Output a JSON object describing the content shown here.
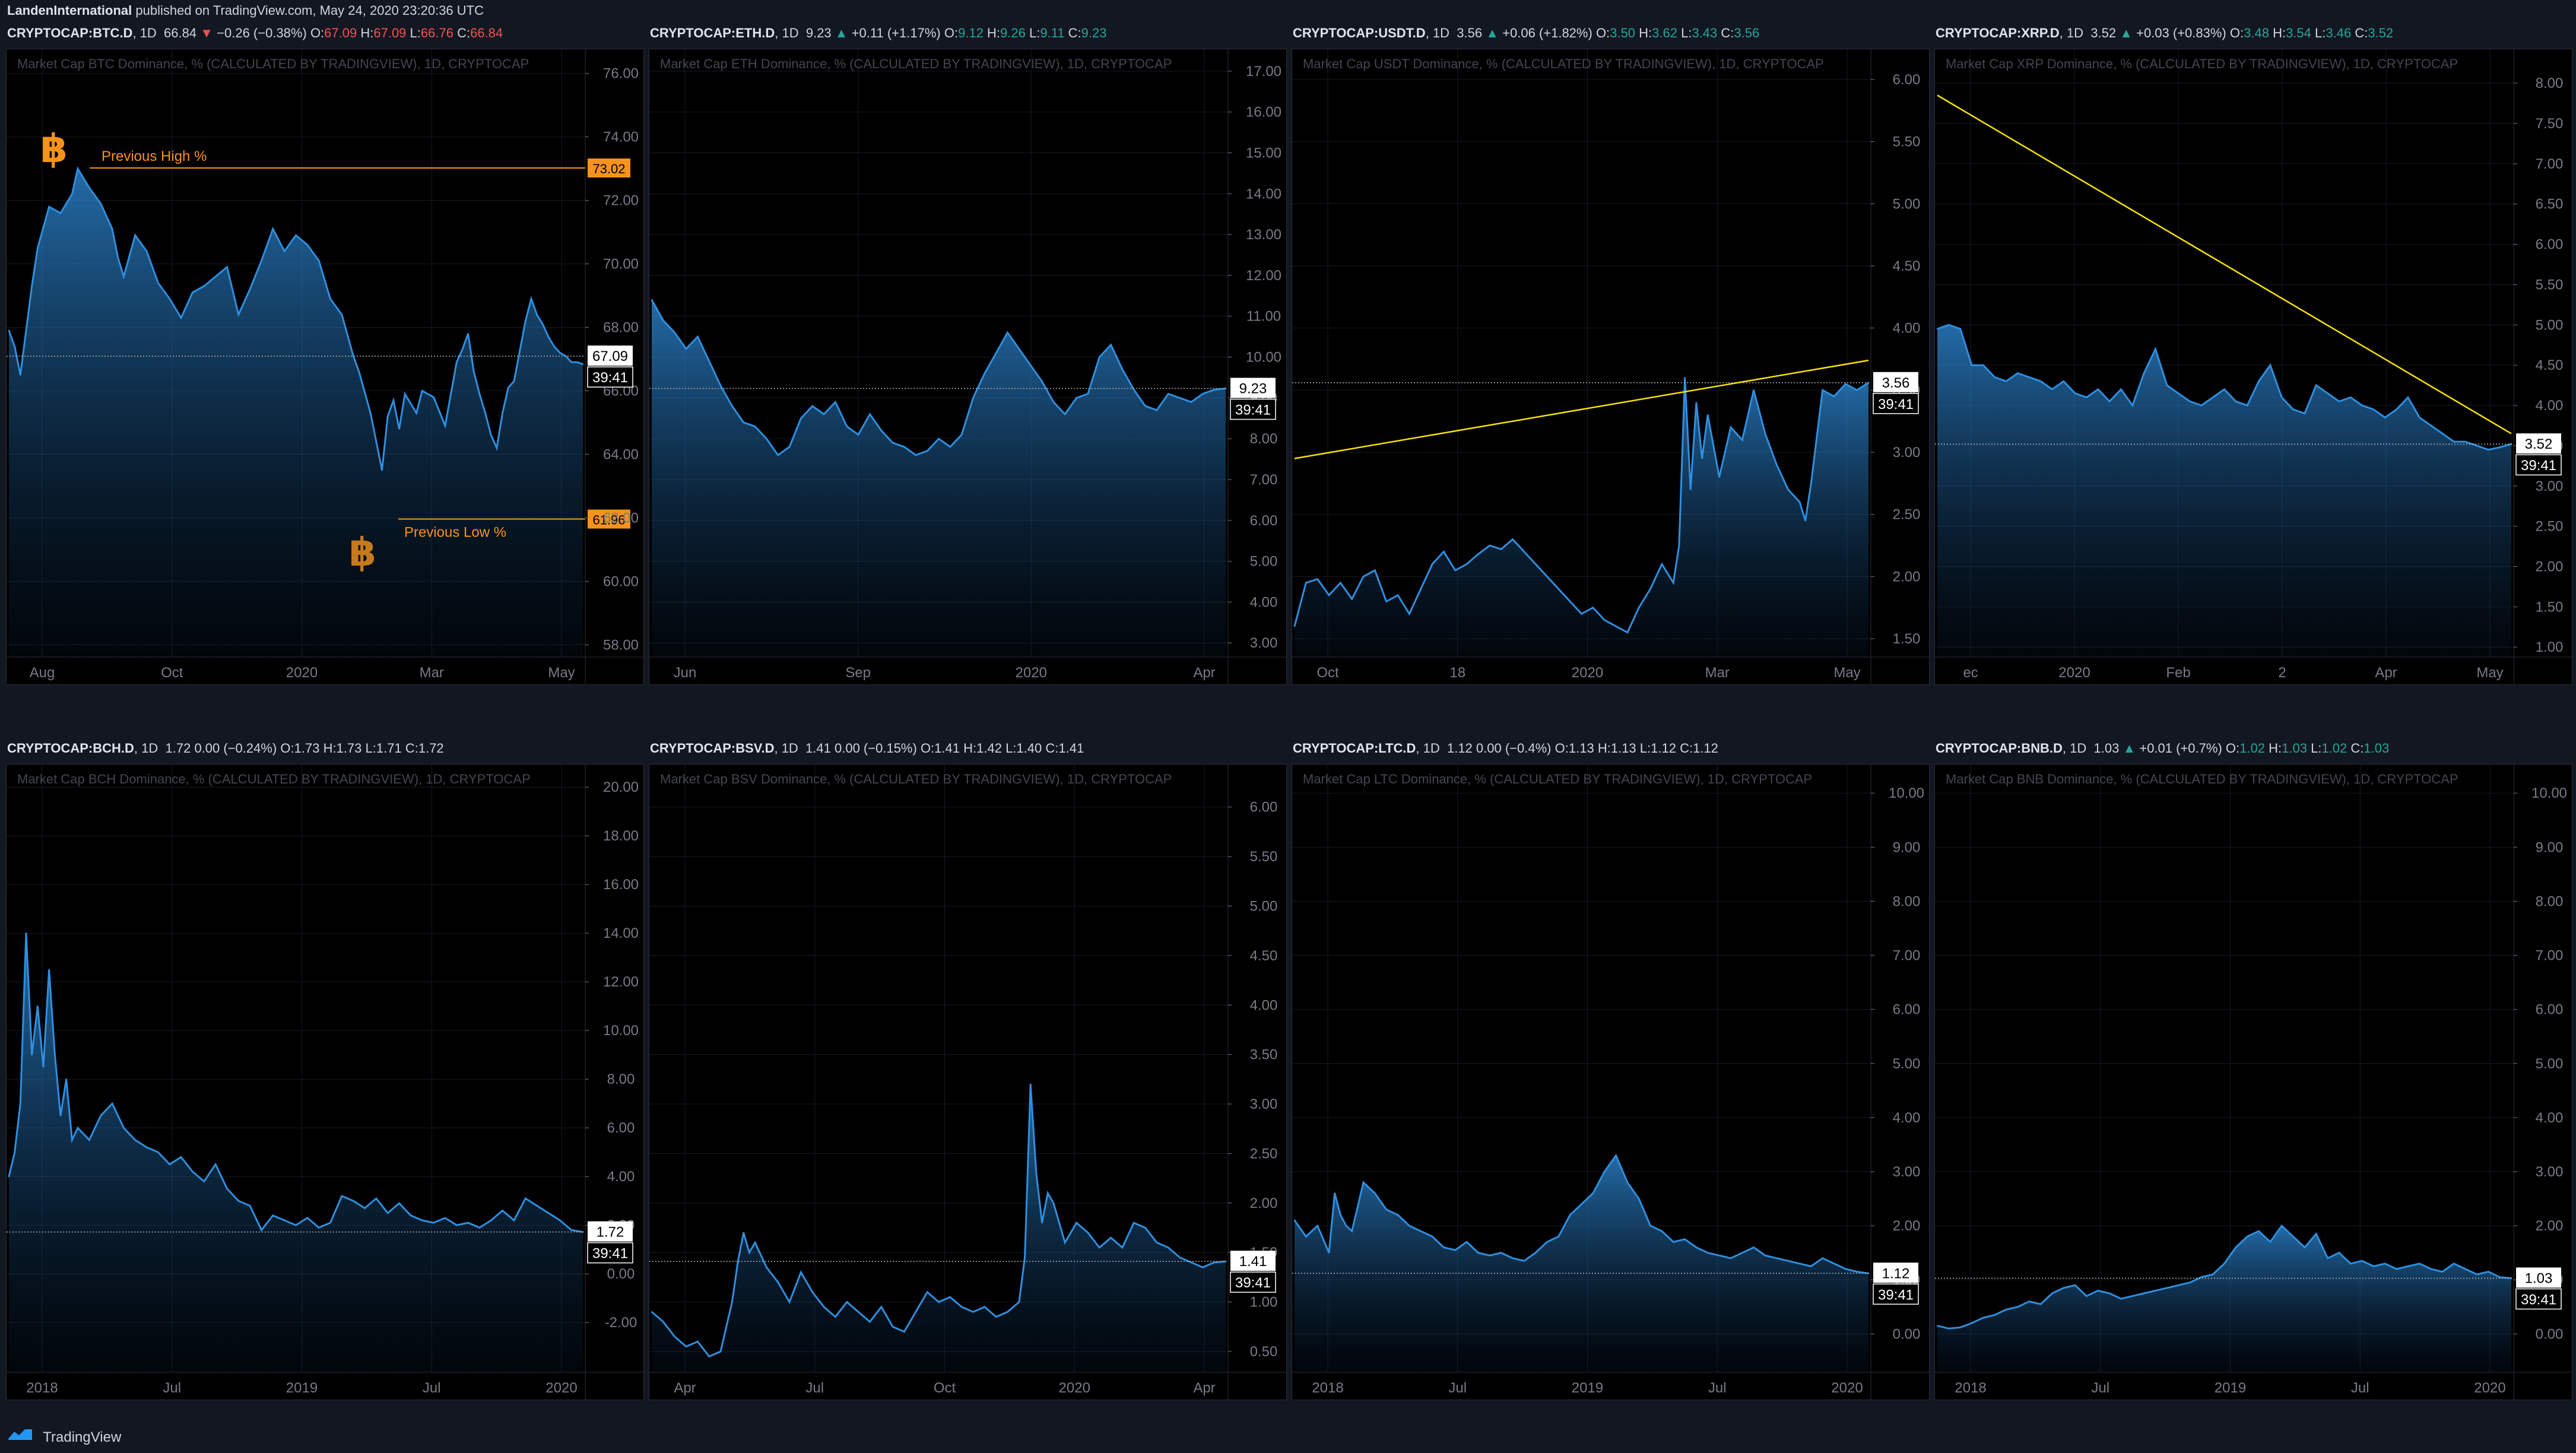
{
  "publish_line": {
    "author": "LandenInternational",
    "text": "published on TradingView.com, May 24, 2020 23:20:36 UTC"
  },
  "footer": {
    "brand": "TradingView"
  },
  "colors": {
    "background": "#131722",
    "chart_bg": "#000000",
    "area_line": "#2f8fe0",
    "trendline": "#f5e100",
    "btc_orange": "#f7931a",
    "up": "#26a69a",
    "down": "#ef5350"
  },
  "icons": [
    "bitcoin-logo-icon",
    "tradingview-logo-icon"
  ],
  "chart_data": [
    {
      "id": "btc",
      "type": "area",
      "symbol": "CRYPTOCAP:BTC.D",
      "interval": "1D",
      "last": "66.84",
      "direction": "down",
      "change": "−0.26 (−0.38%)",
      "ohlc": {
        "O": "67.09",
        "H": "67.09",
        "L": "66.76",
        "C": "66.84"
      },
      "ohlc_color": "down",
      "title": "Market Cap BTC Dominance, % (CALCULATED BY TRADINGVIEW), 1D, CRYPTOCAP",
      "yticks": [
        "76.00",
        "74.00",
        "72.00",
        "70.00",
        "68.00",
        "66.00",
        "64.00",
        "62.00",
        "60.00",
        "58.00"
      ],
      "xticks": [
        "Aug",
        "Oct",
        "2020",
        "Mar",
        "May"
      ],
      "price_label": "67.09",
      "timer": "39:41",
      "ylim": [
        57.8,
        76.2
      ],
      "xlim": [
        0,
        100
      ],
      "x": [
        0,
        1,
        2,
        4,
        5,
        7,
        9,
        11,
        12,
        14,
        16,
        18,
        19,
        20,
        22,
        24,
        26,
        28,
        30,
        32,
        34,
        36,
        38,
        40,
        42,
        44,
        46,
        48,
        50,
        52,
        54,
        56,
        58,
        60,
        61,
        63,
        65,
        66,
        67,
        68,
        69,
        70,
        71,
        72,
        74,
        76,
        78,
        79,
        80,
        81,
        82,
        83,
        84,
        85,
        86,
        87,
        88,
        90,
        91,
        92,
        93,
        94,
        95,
        96,
        97,
        98,
        99,
        100
      ],
      "values": [
        67.9,
        67.4,
        66.5,
        69.3,
        70.5,
        71.8,
        71.6,
        72.2,
        73.0,
        72.4,
        71.9,
        71.1,
        70.2,
        69.6,
        70.9,
        70.4,
        69.4,
        68.9,
        68.3,
        69.1,
        69.3,
        69.6,
        69.9,
        68.4,
        69.2,
        70.1,
        71.1,
        70.4,
        70.9,
        70.6,
        70.1,
        68.9,
        68.4,
        67.1,
        66.6,
        65.3,
        63.5,
        65.2,
        65.7,
        64.8,
        65.9,
        65.6,
        65.3,
        66.0,
        65.8,
        64.9,
        66.9,
        67.3,
        67.8,
        66.6,
        65.9,
        65.3,
        64.6,
        64.2,
        65.3,
        66.1,
        66.3,
        68.2,
        68.9,
        68.4,
        68.1,
        67.7,
        67.4,
        67.2,
        67.1,
        66.9,
        66.9,
        66.84
      ],
      "annotations": [
        {
          "text": "Previous High %",
          "value": 73.02,
          "label": "73.02"
        },
        {
          "text": "Previous Low %",
          "value": 61.96,
          "label": "61.96"
        }
      ]
    },
    {
      "id": "eth",
      "type": "area",
      "symbol": "CRYPTOCAP:ETH.D",
      "interval": "1D",
      "last": "9.23",
      "direction": "up",
      "change": "+0.11 (+1.17%)",
      "ohlc": {
        "O": "9.12",
        "H": "9.26",
        "L": "9.11",
        "C": "9.23"
      },
      "ohlc_color": "up",
      "title": "Market Cap ETH Dominance, % (CALCULATED BY TRADINGVIEW), 1D, CRYPTOCAP",
      "yticks": [
        "17.00",
        "16.00",
        "15.00",
        "14.00",
        "13.00",
        "12.00",
        "11.00",
        "10.00",
        "9.00",
        "8.00",
        "7.00",
        "6.00",
        "5.00",
        "4.00",
        "3.00"
      ],
      "xticks": [
        "Jun",
        "Sep",
        "2020",
        "Apr"
      ],
      "price_label": "9.23",
      "timer": "39:41",
      "ylim": [
        2.8,
        17.1
      ],
      "xlim": [
        0,
        100
      ],
      "x": [
        0,
        2,
        4,
        6,
        8,
        10,
        12,
        14,
        16,
        18,
        20,
        22,
        24,
        26,
        28,
        30,
        32,
        34,
        36,
        38,
        40,
        42,
        44,
        46,
        48,
        50,
        52,
        54,
        56,
        58,
        60,
        62,
        64,
        66,
        68,
        70,
        72,
        74,
        76,
        78,
        80,
        82,
        84,
        86,
        88,
        90,
        92,
        94,
        96,
        98,
        100
      ],
      "values": [
        11.4,
        10.9,
        10.6,
        10.2,
        10.5,
        9.9,
        9.3,
        8.8,
        8.4,
        8.3,
        8.0,
        7.6,
        7.8,
        8.5,
        8.8,
        8.6,
        8.9,
        8.3,
        8.1,
        8.6,
        8.2,
        7.9,
        7.8,
        7.6,
        7.7,
        8.0,
        7.8,
        8.1,
        9.0,
        9.6,
        10.1,
        10.6,
        10.2,
        9.8,
        9.4,
        8.9,
        8.6,
        9.0,
        9.1,
        10.0,
        10.3,
        9.7,
        9.2,
        8.8,
        8.7,
        9.1,
        9.0,
        8.9,
        9.1,
        9.2,
        9.23
      ]
    },
    {
      "id": "usdt",
      "type": "area",
      "symbol": "CRYPTOCAP:USDT.D",
      "interval": "1D",
      "last": "3.56",
      "direction": "up",
      "change": "+0.06 (+1.82%)",
      "ohlc": {
        "O": "3.50",
        "H": "3.62",
        "L": "3.43",
        "C": "3.56"
      },
      "ohlc_color": "up",
      "title": "Market Cap USDT Dominance, % (CALCULATED BY TRADINGVIEW), 1D, CRYPTOCAP",
      "yticks": [
        "6.00",
        "5.50",
        "5.00",
        "4.50",
        "4.00",
        "3.50",
        "3.00",
        "2.50",
        "2.00",
        "1.50"
      ],
      "xticks": [
        "Oct",
        "18",
        "2020",
        "Mar",
        "May"
      ],
      "price_label": "3.56",
      "timer": "39:41",
      "ylim": [
        1.4,
        6.1
      ],
      "xlim": [
        0,
        100
      ],
      "x": [
        0,
        2,
        4,
        6,
        8,
        10,
        12,
        14,
        16,
        18,
        20,
        22,
        24,
        26,
        28,
        30,
        32,
        34,
        36,
        38,
        40,
        42,
        44,
        46,
        48,
        50,
        52,
        54,
        56,
        58,
        60,
        62,
        64,
        66,
        67,
        68,
        69,
        70,
        71,
        72,
        74,
        76,
        78,
        80,
        82,
        84,
        86,
        88,
        89,
        90,
        92,
        94,
        96,
        98,
        100
      ],
      "values": [
        1.6,
        1.95,
        1.98,
        1.85,
        1.95,
        1.82,
        2.0,
        2.05,
        1.8,
        1.85,
        1.7,
        1.9,
        2.1,
        2.2,
        2.05,
        2.1,
        2.18,
        2.25,
        2.22,
        2.3,
        2.2,
        2.1,
        2.0,
        1.9,
        1.8,
        1.7,
        1.75,
        1.65,
        1.6,
        1.55,
        1.75,
        1.9,
        2.1,
        1.95,
        2.25,
        3.6,
        2.7,
        3.4,
        2.95,
        3.3,
        2.8,
        3.2,
        3.1,
        3.5,
        3.15,
        2.9,
        2.7,
        2.6,
        2.45,
        2.75,
        3.5,
        3.45,
        3.55,
        3.5,
        3.56
      ],
      "trendline": [
        [
          0,
          2.95
        ],
        [
          100,
          3.74
        ]
      ]
    },
    {
      "id": "xrp",
      "type": "area",
      "symbol": "CRYPTOCAP:XRP.D",
      "interval": "1D",
      "last": "3.52",
      "direction": "up",
      "change": "+0.03 (+0.83%)",
      "ohlc": {
        "O": "3.48",
        "H": "3.54",
        "L": "3.46",
        "C": "3.52"
      },
      "ohlc_color": "up",
      "title": "Market Cap XRP Dominance, % (CALCULATED BY TRADINGVIEW), 1D, CRYPTOCAP",
      "yticks": [
        "8.00",
        "7.50",
        "7.00",
        "6.50",
        "6.00",
        "5.50",
        "5.00",
        "4.50",
        "4.00",
        "3.50",
        "3.00",
        "2.50",
        "2.00",
        "1.50",
        "1.00"
      ],
      "xticks": [
        "ec",
        "2020",
        "Feb",
        "2",
        "Apr",
        "May"
      ],
      "price_label": "3.52",
      "timer": "39:41",
      "ylim": [
        0.95,
        8.2
      ],
      "xlim": [
        0,
        100
      ],
      "x": [
        0,
        2,
        4,
        6,
        8,
        10,
        12,
        14,
        16,
        18,
        20,
        22,
        24,
        26,
        28,
        30,
        32,
        34,
        36,
        38,
        40,
        42,
        44,
        46,
        48,
        50,
        52,
        54,
        56,
        58,
        60,
        62,
        64,
        66,
        68,
        70,
        72,
        74,
        76,
        78,
        80,
        82,
        84,
        86,
        88,
        90,
        92,
        94,
        96,
        98,
        100
      ],
      "values": [
        4.95,
        5.0,
        4.95,
        4.5,
        4.5,
        4.35,
        4.3,
        4.4,
        4.35,
        4.3,
        4.2,
        4.3,
        4.15,
        4.1,
        4.2,
        4.05,
        4.2,
        4.0,
        4.4,
        4.7,
        4.25,
        4.15,
        4.05,
        4.0,
        4.1,
        4.2,
        4.05,
        4.0,
        4.3,
        4.5,
        4.1,
        3.95,
        3.9,
        4.25,
        4.15,
        4.05,
        4.1,
        4.0,
        3.95,
        3.85,
        3.95,
        4.1,
        3.85,
        3.75,
        3.65,
        3.55,
        3.55,
        3.5,
        3.45,
        3.48,
        3.52
      ],
      "trendline": [
        [
          0,
          7.85
        ],
        [
          100,
          3.65
        ]
      ]
    },
    {
      "id": "bch",
      "type": "area",
      "symbol": "CRYPTOCAP:BCH.D",
      "interval": "1D",
      "last": "1.72",
      "direction": "flat",
      "change": "0.00 (−0.24%)",
      "ohlc": {
        "O": "1.73",
        "H": "1.73",
        "L": "1.71",
        "C": "1.72"
      },
      "ohlc_color": "flat",
      "title": "Market Cap BCH Dominance, % (CALCULATED BY TRADINGVIEW), 1D, CRYPTOCAP",
      "yticks": [
        "20.00",
        "18.00",
        "16.00",
        "14.00",
        "12.00",
        "10.00",
        "8.00",
        "6.00",
        "4.00",
        "2.00",
        "0.00",
        "-2.00"
      ],
      "xticks": [
        "2018",
        "Jul",
        "2019",
        "Jul",
        "2020"
      ],
      "price_label": "1.72",
      "timer": "39:41",
      "ylim": [
        -3.8,
        20.2
      ],
      "xlim": [
        0,
        100
      ],
      "x": [
        0,
        1,
        2,
        3,
        4,
        5,
        6,
        7,
        8,
        9,
        10,
        11,
        12,
        14,
        16,
        18,
        20,
        22,
        24,
        26,
        28,
        30,
        32,
        34,
        36,
        38,
        40,
        42,
        44,
        46,
        48,
        50,
        52,
        54,
        56,
        58,
        60,
        62,
        64,
        66,
        68,
        70,
        72,
        74,
        76,
        78,
        80,
        82,
        84,
        86,
        88,
        90,
        92,
        94,
        96,
        98,
        100
      ],
      "values": [
        4.0,
        5.0,
        7.0,
        14.0,
        9.0,
        11.0,
        8.5,
        12.5,
        9.0,
        6.5,
        8.0,
        5.5,
        6.0,
        5.5,
        6.5,
        7.0,
        6.0,
        5.5,
        5.2,
        5.0,
        4.5,
        4.8,
        4.2,
        3.8,
        4.5,
        3.5,
        3.0,
        2.8,
        1.8,
        2.4,
        2.2,
        2.0,
        2.3,
        1.9,
        2.1,
        3.2,
        3.0,
        2.7,
        3.1,
        2.5,
        2.9,
        2.4,
        2.2,
        2.1,
        2.3,
        2.0,
        2.1,
        1.9,
        2.2,
        2.6,
        2.2,
        3.1,
        2.8,
        2.5,
        2.2,
        1.8,
        1.72
      ]
    },
    {
      "id": "bsv",
      "type": "area",
      "symbol": "CRYPTOCAP:BSV.D",
      "interval": "1D",
      "last": "1.41",
      "direction": "flat",
      "change": "0.00 (−0.15%)",
      "ohlc": {
        "O": "1.41",
        "H": "1.42",
        "L": "1.40",
        "C": "1.41"
      },
      "ohlc_color": "flat",
      "title": "Market Cap BSV Dominance, % (CALCULATED BY TRADINGVIEW), 1D, CRYPTOCAP",
      "yticks": [
        "6.00",
        "5.50",
        "5.00",
        "4.50",
        "4.00",
        "3.50",
        "3.00",
        "2.50",
        "2.00",
        "1.50",
        "1.00",
        "0.50"
      ],
      "xticks": [
        "Apr",
        "Jul",
        "Oct",
        "2020",
        "Apr"
      ],
      "price_label": "1.41",
      "timer": "39:41",
      "ylim": [
        0.35,
        6.25
      ],
      "xlim": [
        0,
        100
      ],
      "x": [
        0,
        2,
        4,
        6,
        8,
        10,
        12,
        14,
        15,
        16,
        17,
        18,
        20,
        22,
        24,
        26,
        28,
        30,
        32,
        34,
        36,
        38,
        40,
        42,
        44,
        46,
        48,
        50,
        52,
        54,
        56,
        58,
        60,
        62,
        64,
        65,
        66,
        67,
        68,
        69,
        70,
        72,
        74,
        76,
        78,
        80,
        82,
        84,
        86,
        88,
        90,
        92,
        94,
        96,
        98,
        100
      ],
      "values": [
        0.9,
        0.8,
        0.65,
        0.55,
        0.6,
        0.45,
        0.5,
        1.0,
        1.4,
        1.7,
        1.5,
        1.6,
        1.35,
        1.2,
        1.0,
        1.3,
        1.1,
        0.95,
        0.85,
        1.0,
        0.9,
        0.8,
        0.95,
        0.75,
        0.7,
        0.9,
        1.1,
        1.0,
        1.05,
        0.95,
        0.9,
        0.95,
        0.85,
        0.9,
        1.0,
        1.45,
        3.2,
        2.3,
        1.8,
        2.1,
        2.0,
        1.6,
        1.8,
        1.7,
        1.55,
        1.65,
        1.55,
        1.8,
        1.75,
        1.6,
        1.55,
        1.45,
        1.4,
        1.35,
        1.4,
        1.41
      ]
    },
    {
      "id": "ltc",
      "type": "area",
      "symbol": "CRYPTOCAP:LTC.D",
      "interval": "1D",
      "last": "1.12",
      "direction": "flat",
      "change": "0.00 (−0.4%)",
      "ohlc": {
        "O": "1.13",
        "H": "1.13",
        "L": "1.12",
        "C": "1.12"
      },
      "ohlc_color": "flat",
      "title": "Market Cap LTC Dominance, % (CALCULATED BY TRADINGVIEW), 1D, CRYPTOCAP",
      "yticks": [
        "10.00",
        "9.00",
        "8.00",
        "7.00",
        "6.00",
        "5.00",
        "4.00",
        "3.00",
        "2.00",
        "1.00",
        "0.00"
      ],
      "xticks": [
        "2018",
        "Jul",
        "2019",
        "Jul",
        "2020"
      ],
      "price_label": "1.12",
      "timer": "39:41",
      "ylim": [
        -0.6,
        10.2
      ],
      "xlim": [
        0,
        100
      ],
      "x": [
        0,
        2,
        4,
        6,
        7,
        8,
        9,
        10,
        12,
        14,
        16,
        18,
        20,
        22,
        24,
        26,
        28,
        30,
        32,
        34,
        36,
        38,
        40,
        42,
        44,
        46,
        48,
        50,
        52,
        54,
        56,
        58,
        60,
        62,
        64,
        66,
        68,
        70,
        72,
        74,
        76,
        78,
        80,
        82,
        84,
        86,
        88,
        90,
        92,
        94,
        96,
        98,
        100
      ],
      "values": [
        2.1,
        1.8,
        2.0,
        1.5,
        2.6,
        2.2,
        2.0,
        1.9,
        2.8,
        2.6,
        2.3,
        2.2,
        2.0,
        1.9,
        1.8,
        1.6,
        1.55,
        1.7,
        1.5,
        1.45,
        1.5,
        1.4,
        1.35,
        1.5,
        1.7,
        1.8,
        2.2,
        2.4,
        2.6,
        3.0,
        3.3,
        2.8,
        2.5,
        2.0,
        1.9,
        1.7,
        1.75,
        1.6,
        1.5,
        1.45,
        1.4,
        1.5,
        1.6,
        1.45,
        1.4,
        1.35,
        1.3,
        1.25,
        1.4,
        1.3,
        1.2,
        1.15,
        1.12
      ]
    },
    {
      "id": "bnb",
      "type": "area",
      "symbol": "CRYPTOCAP:BNB.D",
      "interval": "1D",
      "last": "1.03",
      "direction": "up",
      "change": "+0.01 (+0.7%)",
      "ohlc": {
        "O": "1.02",
        "H": "1.03",
        "L": "1.02",
        "C": "1.03"
      },
      "ohlc_color": "up",
      "title": "Market Cap BNB Dominance, % (CALCULATED BY TRADINGVIEW), 1D, CRYPTOCAP",
      "yticks": [
        "10.00",
        "9.00",
        "8.00",
        "7.00",
        "6.00",
        "5.00",
        "4.00",
        "3.00",
        "2.00",
        "1.00",
        "0.00"
      ],
      "xticks": [
        "2018",
        "Jul",
        "2019",
        "Jul",
        "2020"
      ],
      "price_label": "1.03",
      "timer": "39:41",
      "ylim": [
        -0.6,
        10.2
      ],
      "xlim": [
        0,
        100
      ],
      "x": [
        0,
        2,
        4,
        6,
        8,
        10,
        12,
        14,
        16,
        18,
        20,
        22,
        24,
        26,
        28,
        30,
        32,
        34,
        36,
        38,
        40,
        42,
        44,
        46,
        48,
        50,
        52,
        54,
        56,
        58,
        60,
        62,
        64,
        66,
        68,
        70,
        72,
        74,
        76,
        78,
        80,
        82,
        84,
        86,
        88,
        90,
        92,
        94,
        96,
        98,
        100
      ],
      "values": [
        0.15,
        0.1,
        0.12,
        0.2,
        0.3,
        0.35,
        0.45,
        0.5,
        0.6,
        0.55,
        0.75,
        0.85,
        0.9,
        0.7,
        0.8,
        0.75,
        0.65,
        0.7,
        0.75,
        0.8,
        0.85,
        0.9,
        0.95,
        1.05,
        1.1,
        1.3,
        1.6,
        1.8,
        1.9,
        1.7,
        2.0,
        1.8,
        1.6,
        1.85,
        1.4,
        1.5,
        1.3,
        1.35,
        1.25,
        1.3,
        1.2,
        1.25,
        1.3,
        1.2,
        1.15,
        1.3,
        1.2,
        1.1,
        1.15,
        1.05,
        1.03
      ]
    }
  ]
}
